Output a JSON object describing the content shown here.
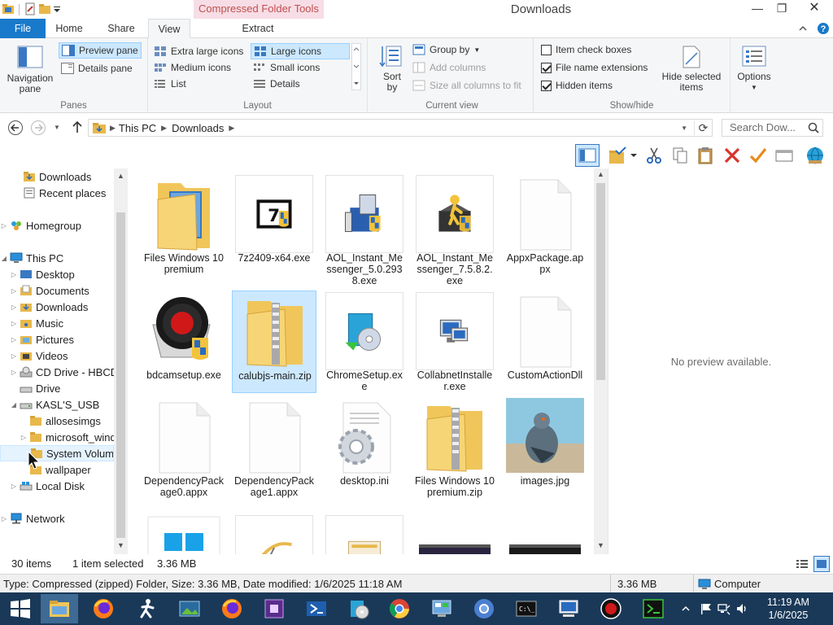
{
  "window": {
    "title": "Downloads",
    "context_tab_header": "Compressed Folder Tools",
    "minimize": "—",
    "restore": "❐",
    "close": "✕"
  },
  "ribbon_tabs": {
    "file": "File",
    "home": "Home",
    "share": "Share",
    "view": "View",
    "extract": "Extract"
  },
  "ribbon": {
    "panes": {
      "label": "Panes",
      "navigation_pane": "Navigation pane",
      "preview_pane": "Preview pane",
      "details_pane": "Details pane"
    },
    "layout": {
      "label": "Layout",
      "extra_large_icons": "Extra large icons",
      "large_icons": "Large icons",
      "medium_icons": "Medium icons",
      "small_icons": "Small icons",
      "list": "List",
      "details": "Details"
    },
    "current_view": {
      "label": "Current view",
      "sort_by": "Sort by",
      "group_by": "Group by",
      "add_columns": "Add columns",
      "size_all_columns": "Size all columns to fit"
    },
    "show_hide": {
      "label": "Show/hide",
      "item_check_boxes": "Item check boxes",
      "file_name_extensions": "File name extensions",
      "hidden_items": "Hidden items",
      "hide_selected_items": "Hide selected items"
    },
    "options": "Options"
  },
  "address": {
    "crumb_1": "This PC",
    "crumb_2": "Downloads",
    "search_placeholder": "Search Dow..."
  },
  "nav": [
    {
      "label": "Downloads"
    },
    {
      "label": "Recent places"
    },
    {
      "label": "Homegroup"
    },
    {
      "label": "This PC"
    },
    {
      "label": "Desktop"
    },
    {
      "label": "Documents"
    },
    {
      "label": "Downloads"
    },
    {
      "label": "Music"
    },
    {
      "label": "Pictures"
    },
    {
      "label": "Videos"
    },
    {
      "label": "CD Drive - HBCD"
    },
    {
      "label": "Drive"
    },
    {
      "label": "KASL'S_USB"
    },
    {
      "label": "allosesimgs"
    },
    {
      "label": "microsoft_windows"
    },
    {
      "label": "System Volume"
    },
    {
      "label": "wallpaper"
    },
    {
      "label": "Local Disk"
    },
    {
      "label": "Network"
    }
  ],
  "files": [
    {
      "name": "Files Windows 10 premium"
    },
    {
      "name": "7z2409-x64.exe"
    },
    {
      "name": "AOL_Instant_Messenger_5.0.2938.exe"
    },
    {
      "name": "AOL_Instant_Messenger_7.5.8.2.exe"
    },
    {
      "name": "AppxPackage.appx"
    },
    {
      "name": "bdcamsetup.exe"
    },
    {
      "name": "calubjs-main.zip"
    },
    {
      "name": "ChromeSetup.exe"
    },
    {
      "name": "CollabnetInstaller.exe"
    },
    {
      "name": "CustomActionDll"
    },
    {
      "name": "DependencyPackage0.appx"
    },
    {
      "name": "DependencyPackage1.appx"
    },
    {
      "name": "desktop.ini"
    },
    {
      "name": "Files Windows 10 premium.zip"
    },
    {
      "name": "images.jpg"
    }
  ],
  "preview": {
    "text": "No preview available."
  },
  "status": {
    "items": "30 items",
    "selected": "1 item selected",
    "size": "3.36 MB"
  },
  "details_bar": {
    "text": "Type: Compressed (zipped) Folder, Size: 3.36 MB, Date modified: 1/6/2025 11:18 AM",
    "size": "3.36 MB",
    "location": "Computer"
  },
  "clock": {
    "time": "11:19 AM",
    "date": "1/6/2025"
  }
}
